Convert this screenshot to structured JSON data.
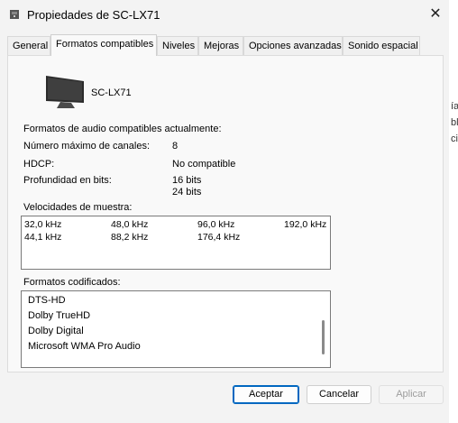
{
  "window": {
    "title": "Propiedades de SC-LX71",
    "close_glyph": "✕"
  },
  "tabs": [
    {
      "label": "General"
    },
    {
      "label": "Formatos compatibles"
    },
    {
      "label": "Niveles"
    },
    {
      "label": "Mejoras"
    },
    {
      "label": "Opciones avanzadas"
    },
    {
      "label": "Sonido espacial"
    }
  ],
  "device": {
    "name": "SC-LX71",
    "icon": "monitor-icon"
  },
  "supported": {
    "heading": "Formatos de audio compatibles actualmente:",
    "max_channels_label": "Número máximo de canales:",
    "max_channels_value": "8",
    "hdcp_label": "HDCP:",
    "hdcp_value": "No compatible",
    "bit_depth_label": "Profundidad en bits:",
    "bit_depth_values": [
      "16 bits",
      "24 bits"
    ]
  },
  "sample_rates": {
    "label": "Velocidades de muestra:",
    "row1": [
      "32,0 kHz",
      "48,0 kHz",
      "96,0 kHz",
      "192,0 kHz"
    ],
    "row2": [
      "44,1 kHz",
      "88,2 kHz",
      "176,4 kHz"
    ]
  },
  "encoded": {
    "label": "Formatos codificados:",
    "items": [
      "DTS-HD",
      "Dolby TrueHD",
      "Dolby Digital",
      "Microsoft WMA Pro Audio"
    ]
  },
  "buttons": {
    "accept": "Aceptar",
    "cancel": "Cancelar",
    "apply": "Aplicar"
  },
  "background_glyphs": [
    "ía",
    "ble",
    "ci"
  ]
}
